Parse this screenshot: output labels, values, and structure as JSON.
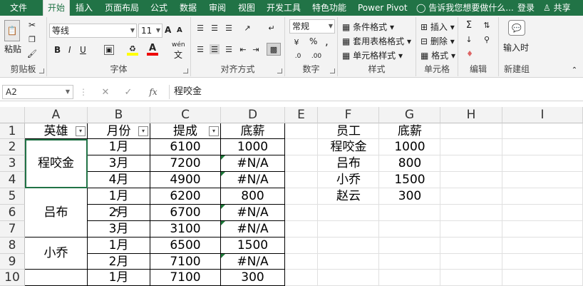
{
  "tabs": [
    "文件",
    "开始",
    "插入",
    "页面布局",
    "公式",
    "数据",
    "审阅",
    "视图",
    "开发工具",
    "特色功能",
    "Power Pivot"
  ],
  "tell_me": "告诉我您想要做什么...",
  "login": "登录",
  "share": "共享",
  "clipboard": {
    "paste": "粘贴",
    "label": "剪贴板"
  },
  "font": {
    "name": "等线",
    "size": "11",
    "label": "字体",
    "bold": "B",
    "italic": "I",
    "underline": "U",
    "grow": "A",
    "shrink": "A",
    "wen": "wén",
    "wen2": "文"
  },
  "align": {
    "label": "对齐方式"
  },
  "number": {
    "format": "常规",
    "pct": "%",
    "comma": ",",
    "label": "数字"
  },
  "styles": {
    "cond": "条件格式",
    "table": "套用表格格式",
    "cell": "单元格样式",
    "label": "样式"
  },
  "cells": {
    "insert": "插入",
    "delete": "删除",
    "format": "格式",
    "label": "单元格"
  },
  "editing": {
    "label": "编辑"
  },
  "newgroup": {
    "input": "输入时",
    "label": "新建组"
  },
  "namebox": "A2",
  "formula": "程咬金",
  "fx": "fx",
  "col_headers": [
    "A",
    "B",
    "C",
    "D",
    "E",
    "F",
    "G",
    "H",
    "I"
  ],
  "row_headers": [
    "1",
    "2",
    "3",
    "4",
    "5",
    "6",
    "7",
    "8",
    "9",
    "10"
  ],
  "table": {
    "header": [
      "英雄",
      "月份",
      "提成",
      "底薪"
    ],
    "heroes": [
      "程咬金",
      "吕布",
      "小乔"
    ],
    "months": [
      "1月",
      "3月",
      "4月",
      "1月",
      "2月",
      "3月",
      "1月",
      "2月",
      "1月"
    ],
    "commission": [
      "6100",
      "7200",
      "4900",
      "6200",
      "6700",
      "3100",
      "6500",
      "7100",
      "7100"
    ],
    "salary": [
      "1000",
      "#N/A",
      "#N/A",
      "800",
      "#N/A",
      "#N/A",
      "1500",
      "#N/A",
      "300"
    ]
  },
  "lookup": {
    "header": [
      "员工",
      "底薪"
    ],
    "names": [
      "程咬金",
      "吕布",
      "小乔",
      "赵云"
    ],
    "values": [
      "1000",
      "800",
      "1500",
      "300"
    ]
  },
  "colors": {
    "brand": "#217346",
    "error_marker": "#1e7b3a"
  }
}
